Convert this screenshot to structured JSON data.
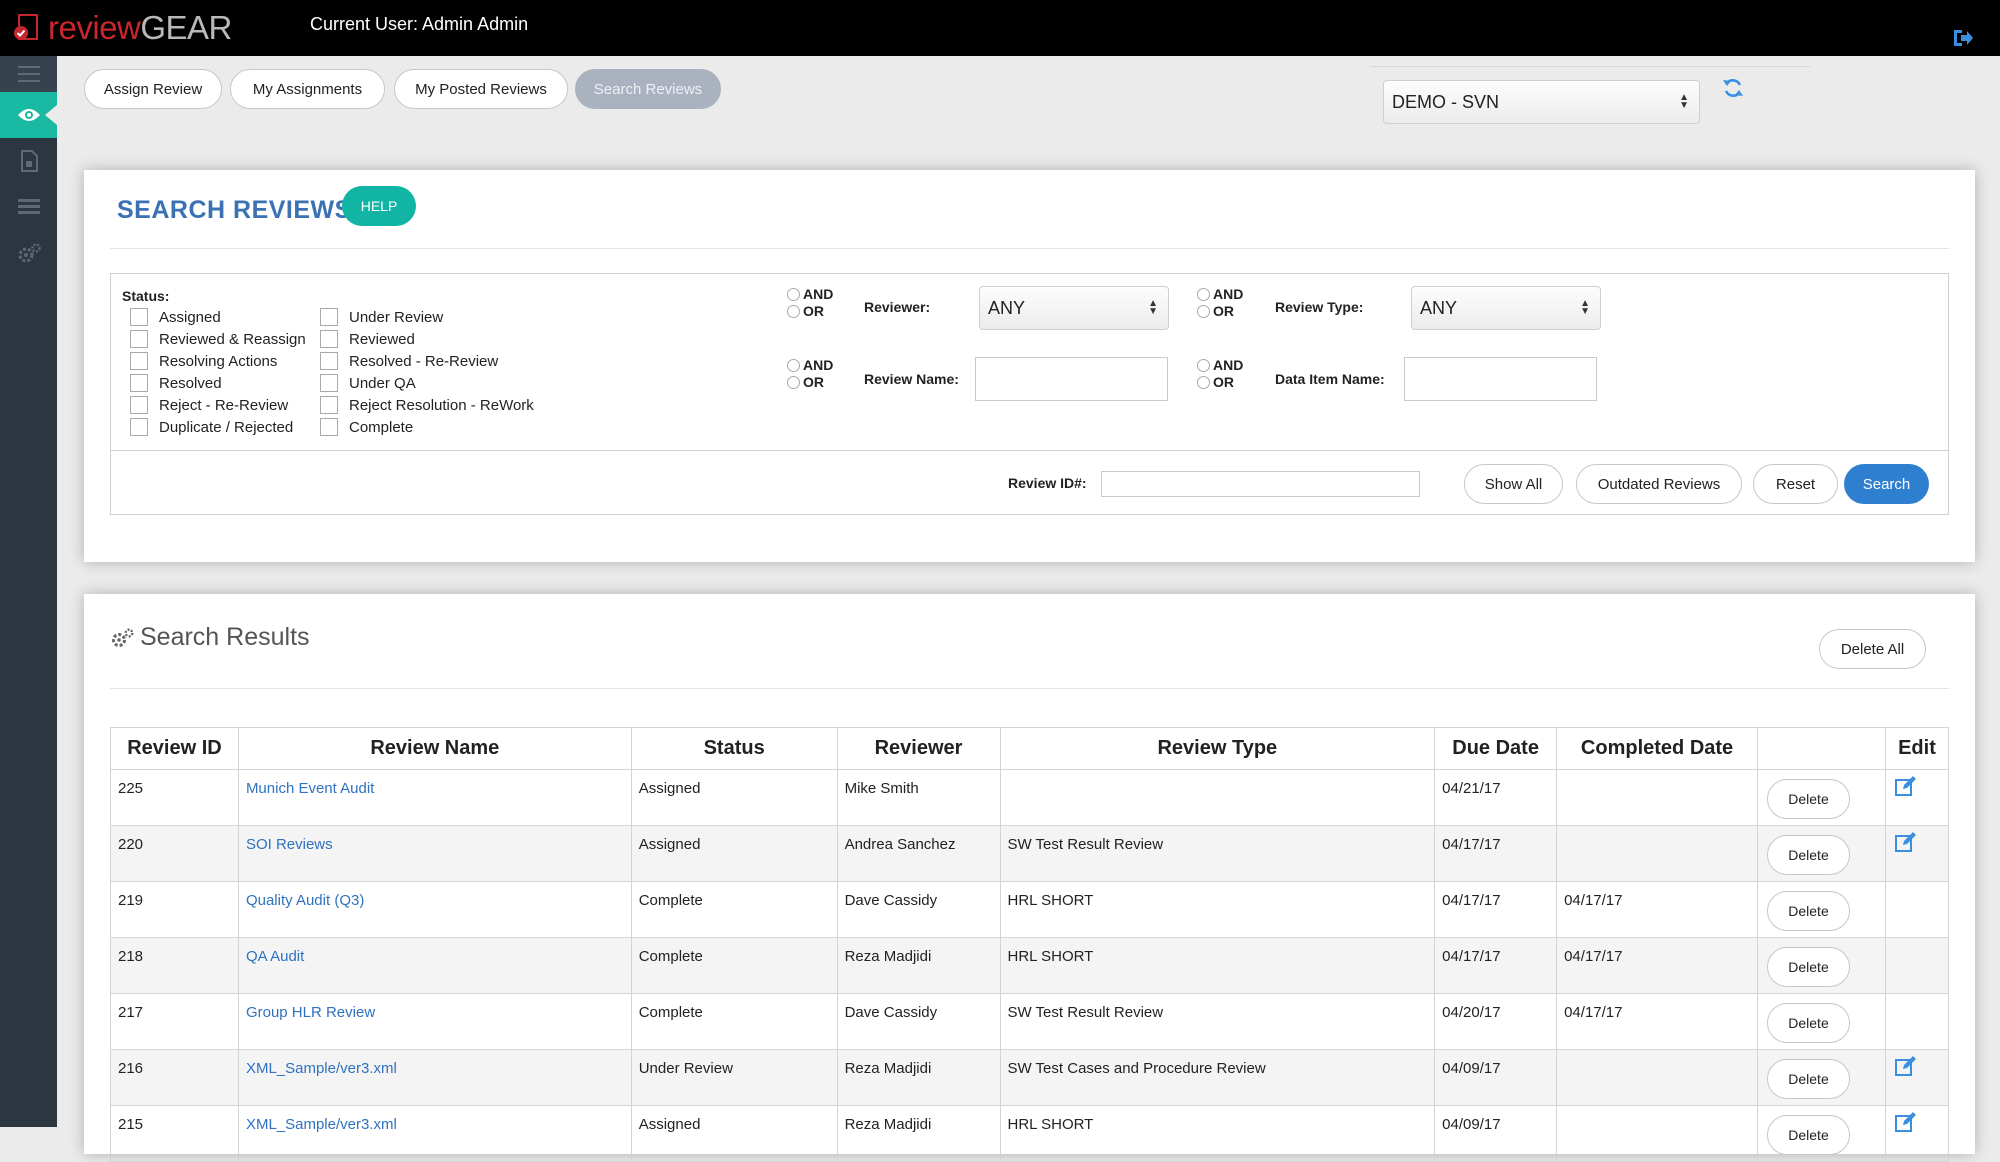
{
  "app": {
    "logo_part1": "review",
    "logo_part2": "GEAR",
    "current_user": "Current User: Admin Admin"
  },
  "tabs": [
    {
      "label": "Assign Review"
    },
    {
      "label": "My Assignments"
    },
    {
      "label": "My Posted Reviews"
    },
    {
      "label": "Search Reviews"
    }
  ],
  "project_select": "DEMO - SVN",
  "search": {
    "title": "SEARCH REVIEWS",
    "help": "HELP",
    "status_label": "Status:",
    "status_col1": [
      "Assigned",
      "Reviewed & Reassign",
      "Resolving Actions",
      "Resolved",
      "Reject - Re-Review",
      "Duplicate / Rejected"
    ],
    "status_col2": [
      "Under Review",
      "Reviewed",
      "Resolved - Re-Review",
      "Under QA",
      "Reject Resolution - ReWork",
      "Complete"
    ],
    "and": "AND",
    "or": "OR",
    "reviewer_label": "Reviewer:",
    "reviewer_value": "ANY",
    "review_type_label": "Review Type:",
    "review_type_value": "ANY",
    "review_name_label": "Review Name:",
    "data_item_label": "Data Item Name:",
    "review_id_label": "Review ID#:",
    "show_all": "Show All",
    "outdated": "Outdated Reviews",
    "reset": "Reset",
    "search_btn": "Search"
  },
  "results": {
    "title": "Search Results",
    "delete_all": "Delete All",
    "headers": [
      "Review ID",
      "Review Name",
      "Status",
      "Reviewer",
      "Review Type",
      "Due Date",
      "Completed Date",
      "",
      "Edit"
    ],
    "delete_label": "Delete",
    "rows": [
      {
        "id": "225",
        "name": "Munich Event Audit",
        "status": "Assigned",
        "reviewer": "Mike Smith",
        "type": "",
        "due": "04/21/17",
        "completed": "",
        "editable": true
      },
      {
        "id": "220",
        "name": "SOI Reviews",
        "status": "Assigned",
        "reviewer": "Andrea Sanchez",
        "type": "SW Test Result Review",
        "due": "04/17/17",
        "completed": "",
        "editable": true
      },
      {
        "id": "219",
        "name": "Quality Audit (Q3)",
        "status": "Complete",
        "reviewer": "Dave Cassidy",
        "type": "HRL SHORT",
        "due": "04/17/17",
        "completed": "04/17/17",
        "editable": false
      },
      {
        "id": "218",
        "name": "QA Audit",
        "status": "Complete",
        "reviewer": "Reza Madjidi",
        "type": "HRL SHORT",
        "due": "04/17/17",
        "completed": "04/17/17",
        "editable": false
      },
      {
        "id": "217",
        "name": "Group HLR Review",
        "status": "Complete",
        "reviewer": "Dave Cassidy",
        "type": "SW Test Result Review",
        "due": "04/20/17",
        "completed": "04/17/17",
        "editable": false
      },
      {
        "id": "216",
        "name": "XML_Sample/ver3.xml",
        "status": "Under Review",
        "reviewer": "Reza Madjidi",
        "type": "SW Test Cases and Procedure Review",
        "due": "04/09/17",
        "completed": "",
        "editable": true
      },
      {
        "id": "215",
        "name": "XML_Sample/ver3.xml",
        "status": "Assigned",
        "reviewer": "Reza Madjidi",
        "type": "HRL SHORT",
        "due": "04/09/17",
        "completed": "",
        "editable": true
      }
    ]
  },
  "colors": {
    "topbar": "#000000",
    "sidenav": "#2b3640",
    "accent_teal": "#19b9a3",
    "title_blue": "#3b72b4",
    "search_blue": "#2f7fd1",
    "link_blue": "#2f72c0",
    "logo_red": "#c8262e"
  },
  "icons": {
    "menu": "hamburger-icon",
    "reviews": "eye-icon",
    "documents": "document-icon",
    "list": "list-icon",
    "settings": "gears-icon",
    "logout": "logout-icon",
    "refresh": "refresh-icon",
    "edit": "edit-icon"
  }
}
